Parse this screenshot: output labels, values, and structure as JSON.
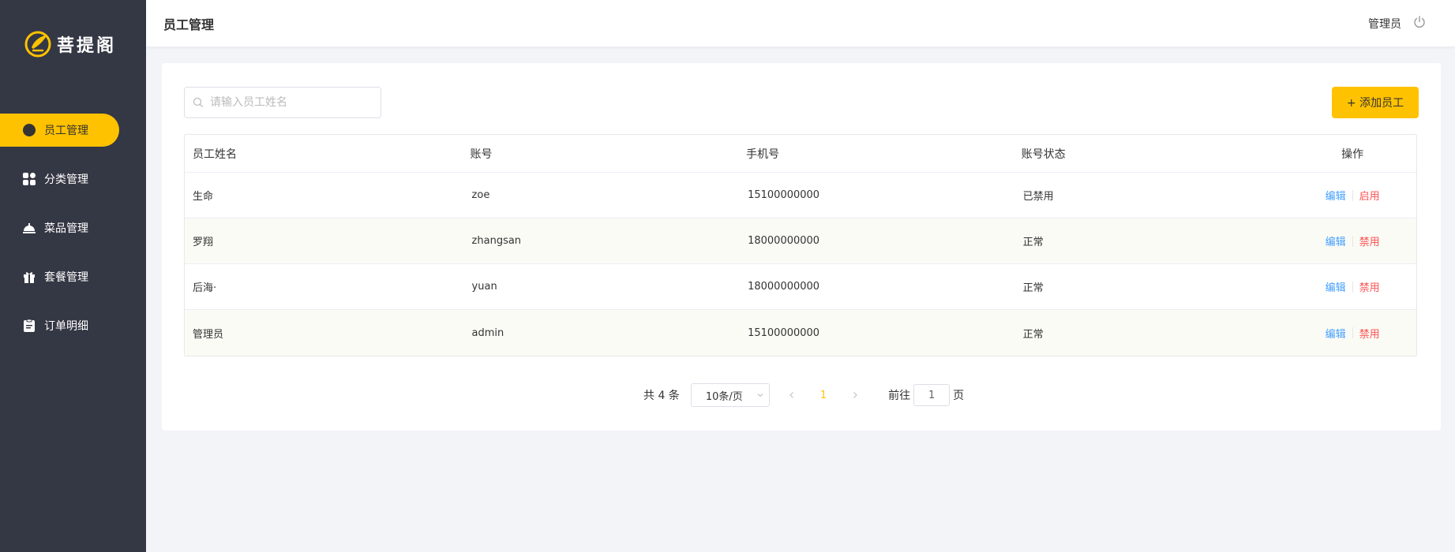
{
  "brand": {
    "name": "菩提阁",
    "accent": "#ffc200"
  },
  "sidebar": {
    "items": [
      {
        "label": "员工管理",
        "icon": "employee-icon",
        "active": true
      },
      {
        "label": "分类管理",
        "icon": "category-icon",
        "active": false
      },
      {
        "label": "菜品管理",
        "icon": "dish-icon",
        "active": false
      },
      {
        "label": "套餐管理",
        "icon": "combo-gift-icon",
        "active": false
      },
      {
        "label": "订单明细",
        "icon": "order-clipboard-icon",
        "active": false
      }
    ]
  },
  "header": {
    "title": "员工管理",
    "user": "管理员",
    "logout_icon": "power-icon"
  },
  "search": {
    "placeholder": "请输入员工姓名",
    "value": ""
  },
  "toolbar": {
    "add_label": "+ 添加员工"
  },
  "table": {
    "columns": [
      "员工姓名",
      "账号",
      "手机号",
      "账号状态",
      "操作"
    ],
    "rows": [
      {
        "name": "生命",
        "account": "zoe",
        "phone": "15100000000",
        "status": "已禁用",
        "edit": "编辑",
        "toggle": "启用"
      },
      {
        "name": "罗翔",
        "account": "zhangsan",
        "phone": "18000000000",
        "status": "正常",
        "edit": "编辑",
        "toggle": "禁用"
      },
      {
        "name": "后海·",
        "account": "yuan",
        "phone": "18000000000",
        "status": "正常",
        "edit": "编辑",
        "toggle": "禁用"
      },
      {
        "name": "管理员",
        "account": "admin",
        "phone": "15100000000",
        "status": "正常",
        "edit": "编辑",
        "toggle": "禁用"
      }
    ]
  },
  "pagination": {
    "total_label": "共 4 条",
    "page_size": "10条/页",
    "current_page": "1",
    "goto_label": "前往",
    "goto_value": "1",
    "page_suffix": "页"
  }
}
